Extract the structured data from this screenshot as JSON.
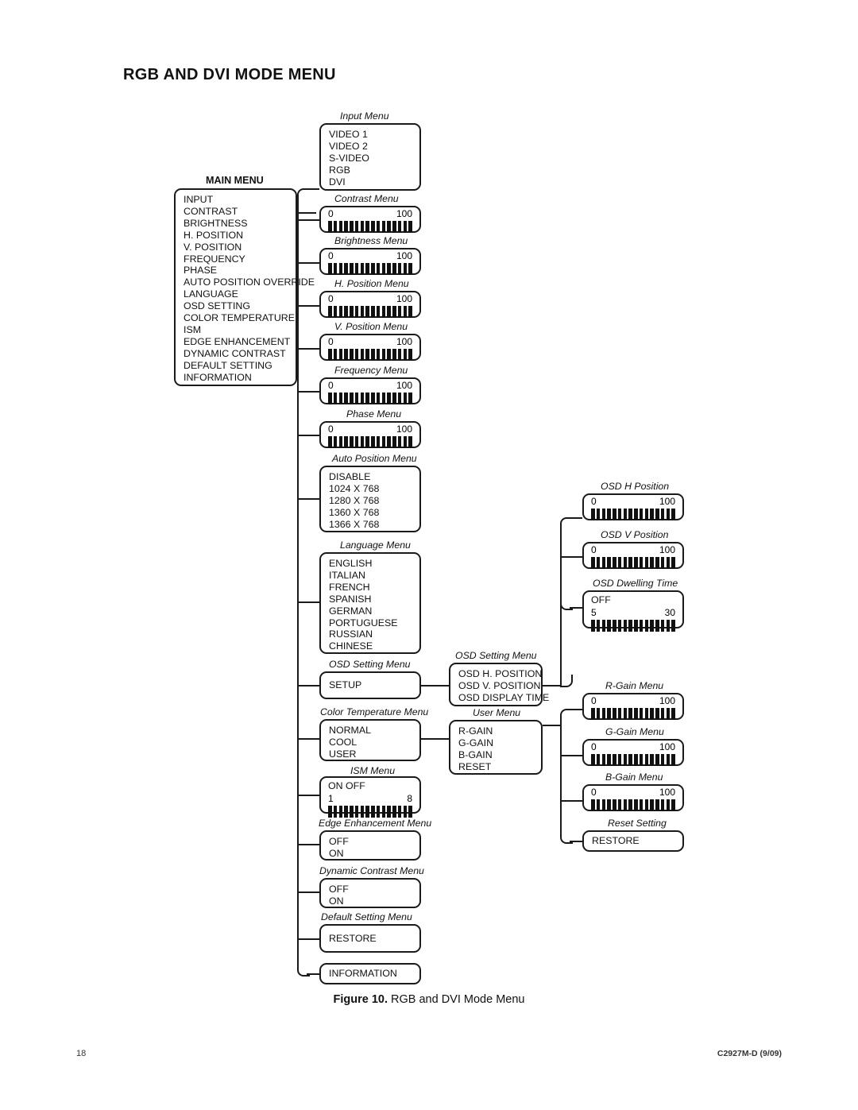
{
  "page": {
    "title": "RGB AND DVI MODE MENU",
    "figure_caption_label": "Figure 10.",
    "figure_caption_text": "RGB and DVI Mode Menu",
    "page_number": "18",
    "doc_code": "C2927M-D (9/09)"
  },
  "diagram": {
    "main_menu": {
      "label": "MAIN MENU",
      "items": [
        "INPUT",
        "CONTRAST",
        "BRIGHTNESS",
        "H. POSITION",
        "V. POSITION",
        "FREQUENCY",
        "PHASE",
        "AUTO POSITION OVERRIDE",
        "LANGUAGE",
        "OSD SETTING",
        "COLOR TEMPERATURE",
        "ISM",
        "EDGE ENHANCEMENT",
        "DYNAMIC CONTRAST",
        "DEFAULT SETTING",
        "INFORMATION"
      ]
    },
    "input_menu": {
      "label": "Input Menu",
      "items": [
        "VIDEO 1",
        "VIDEO 2",
        "S-VIDEO",
        "RGB",
        "DVI"
      ]
    },
    "contrast_menu": {
      "label": "Contrast Menu",
      "min": "0",
      "max": "100"
    },
    "brightness_menu": {
      "label": "Brightness Menu",
      "min": "0",
      "max": "100"
    },
    "h_position_menu": {
      "label": "H. Position Menu",
      "min": "0",
      "max": "100"
    },
    "v_position_menu": {
      "label": "V. Position Menu",
      "min": "0",
      "max": "100"
    },
    "frequency_menu": {
      "label": "Frequency Menu",
      "min": "0",
      "max": "100"
    },
    "phase_menu": {
      "label": "Phase Menu",
      "min": "0",
      "max": "100"
    },
    "auto_position_menu": {
      "label": "Auto Position Menu",
      "items": [
        "DISABLE",
        "1024 X 768",
        "1280 X 768",
        "1360 X 768",
        "1366 X 768"
      ]
    },
    "language_menu": {
      "label": "Language Menu",
      "items": [
        "ENGLISH",
        "ITALIAN",
        "FRENCH",
        "SPANISH",
        "GERMAN",
        "PORTUGUESE",
        "RUSSIAN",
        "CHINESE"
      ]
    },
    "osd_setting_menu": {
      "label": "OSD Setting Menu",
      "items": [
        "SETUP"
      ]
    },
    "osd_setting_submenu": {
      "label": "OSD Setting  Menu",
      "items": [
        "OSD H. POSITION",
        "OSD V. POSITION",
        "OSD DISPLAY TIME"
      ]
    },
    "osd_h_position": {
      "label": "OSD H Position",
      "min": "0",
      "max": "100"
    },
    "osd_v_position": {
      "label": "OSD V Position",
      "min": "0",
      "max": "100"
    },
    "osd_dwelling_time": {
      "label": "OSD Dwelling Time",
      "pre": "OFF",
      "min": "5",
      "max": "30"
    },
    "color_temperature_menu": {
      "label": "Color Temperature Menu",
      "items": [
        "NORMAL",
        "COOL",
        "USER"
      ]
    },
    "user_menu": {
      "label": "User Menu",
      "items": [
        "R-GAIN",
        "G-GAIN",
        "B-GAIN",
        "RESET"
      ]
    },
    "r_gain_menu": {
      "label": "R-Gain Menu",
      "min": "0",
      "max": "100"
    },
    "g_gain_menu": {
      "label": "G-Gain Menu",
      "min": "0",
      "max": "100"
    },
    "b_gain_menu": {
      "label": "B-Gain Menu",
      "min": "0",
      "max": "100"
    },
    "reset_setting": {
      "label": "Reset Setting",
      "items": [
        "RESTORE"
      ]
    },
    "ism_menu": {
      "label": "ISM Menu",
      "pre": "ON OFF",
      "min": "1",
      "max": "8"
    },
    "edge_enhancement_menu": {
      "label": "Edge Enhancement Menu",
      "items": [
        "OFF",
        "ON"
      ]
    },
    "dynamic_contrast_menu": {
      "label": "Dynamic Contrast Menu",
      "items": [
        "OFF",
        "ON"
      ]
    },
    "default_setting_menu": {
      "label": "Default Setting Menu",
      "items": [
        "RESTORE"
      ]
    },
    "information_menu": {
      "label": "",
      "items": [
        "INFORMATION"
      ]
    }
  }
}
